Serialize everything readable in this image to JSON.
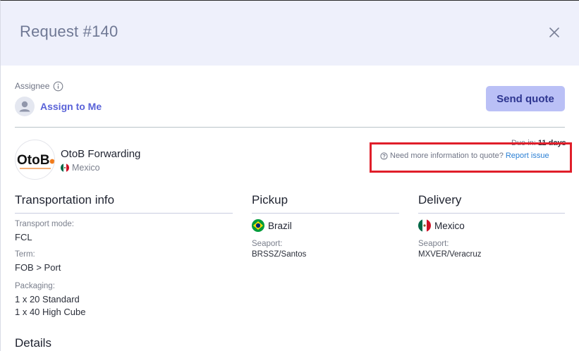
{
  "modal": {
    "title": "Request #140"
  },
  "assignee": {
    "label": "Assignee",
    "assign_link": "Assign to Me"
  },
  "actions": {
    "send_quote": "Send quote"
  },
  "company": {
    "name": "OtoB Forwarding",
    "country": "Mexico",
    "logo_text": "OtoB"
  },
  "due": {
    "label": "Due in:",
    "value": "11 days"
  },
  "report": {
    "prompt": "Need more information to quote?",
    "link": "Report issue"
  },
  "transportation": {
    "title": "Transportation info",
    "fields": [
      {
        "label": "Transport mode:",
        "values": [
          "FCL"
        ]
      },
      {
        "label": "Term:",
        "values": [
          "FOB > Port"
        ]
      },
      {
        "label": "Packaging:",
        "values": [
          "1 x 20 Standard",
          "1 x 40 High Cube"
        ]
      }
    ]
  },
  "pickup": {
    "title": "Pickup",
    "country": "Brazil",
    "seaport_label": "Seaport:",
    "seaport_value": "BRSSZ/Santos"
  },
  "delivery": {
    "title": "Delivery",
    "country": "Mexico",
    "seaport_label": "Seaport:",
    "seaport_value": "MXVER/Veracruz"
  },
  "details": {
    "title": "Details"
  },
  "colors": {
    "header_bg": "#eef0fb",
    "accent": "#5a63d8",
    "button_bg": "#bac0f6",
    "link": "#2a7fd4",
    "highlight": "#e01e2a"
  }
}
